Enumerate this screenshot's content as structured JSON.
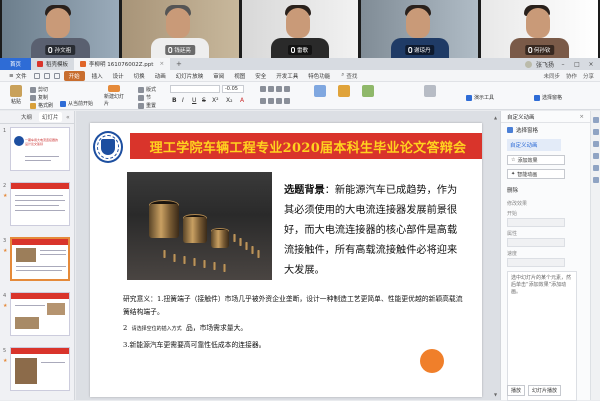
{
  "videos": [
    {
      "name": "孙文祖",
      "bg": "#8a9aa6",
      "shirt": "#5a6070"
    },
    {
      "name": "钱廷亮",
      "bg": "#b7a58c",
      "shirt": "#eeeeee"
    },
    {
      "name": "雷歌",
      "bg": "#e6e6e6",
      "shirt": "#2a2a2a"
    },
    {
      "name": "谢琼丹",
      "bg": "#9aa6b0",
      "shirt": "#1f3b66"
    },
    {
      "name": "何孙钦",
      "bg": "#f1f1f1",
      "shirt": "#7a5a48"
    }
  ],
  "tabbar": {
    "home": "首页",
    "tabs": [
      {
        "label": "稻壳模板",
        "color": "#d9342b"
      },
      {
        "label": "李柳明 161076002Z.ppt",
        "color": "#e0662a"
      }
    ],
    "add": "+",
    "user": "张飞扬",
    "win": [
      "–",
      "□",
      "×"
    ]
  },
  "menubar": {
    "file": "文件",
    "items": [
      "开始",
      "插入",
      "设计",
      "切换",
      "动画",
      "幻灯片放映",
      "审阅",
      "视图",
      "安全",
      "开发工具",
      "特色功能"
    ],
    "search": "查找",
    "right": [
      "未同步",
      "协作",
      "分享"
    ]
  },
  "ribbon": {
    "big": [
      "粘贴",
      "新建幻灯片"
    ],
    "small": [
      "剪切",
      "复制",
      "格式刷",
      "从当前开始",
      "版式",
      "节",
      "重置"
    ],
    "font_size": "-0.05",
    "right": [
      "演示工具",
      "选择窗格"
    ],
    "fmt": [
      "B",
      "I",
      "U",
      "S",
      "X²",
      "X₂",
      "A"
    ]
  },
  "leftpanel": {
    "tabs": [
      "大纲",
      "幻灯片"
    ],
    "thumbs": [
      {
        "num": "1",
        "title": "一期车用大电流连接器的设计论文答辩"
      },
      {
        "num": "2",
        "title": ""
      },
      {
        "num": "3",
        "title": ""
      },
      {
        "num": "4",
        "title": ""
      },
      {
        "num": "5",
        "title": ""
      }
    ]
  },
  "slide": {
    "title": "理工学院车辆工程专业2020届本科生毕业论文答辩会",
    "bg_label": "选题背景",
    "bg_text": "：新能源汽车已成趋势，作为其必须使用的大电流连接器发展前景很好，而大电流连接器的核心部件是高载流接触件，所有高载流接触件必将迎来大发展。",
    "meaning": [
      "研究意义：1.扭簧端子（接触件）市场几乎被外资企业垄断，设计一种制造工艺更简单、性能更优越的新颖高载流簧结构端子。",
      "2",
      "请选择空位的插入方式",
      "品，市场需求量大。",
      "3.新能源汽车更需要高可靠性低成本的连接器。"
    ]
  },
  "rightpanel": {
    "head": "自定义动画",
    "select": "选择窗格",
    "custom": "自定义动画",
    "add_effect": "添加效果",
    "smart": "智能动画",
    "delete": "删除",
    "modify": "修改效果",
    "start_label": "开始",
    "prop_label": "属性",
    "speed_label": "速度",
    "list_hint": "选中幻灯片的某个元素，然后单击“添加效果”添加动画。",
    "bottom": [
      "播放",
      "幻灯片播放"
    ],
    "auto": "自动预览"
  }
}
